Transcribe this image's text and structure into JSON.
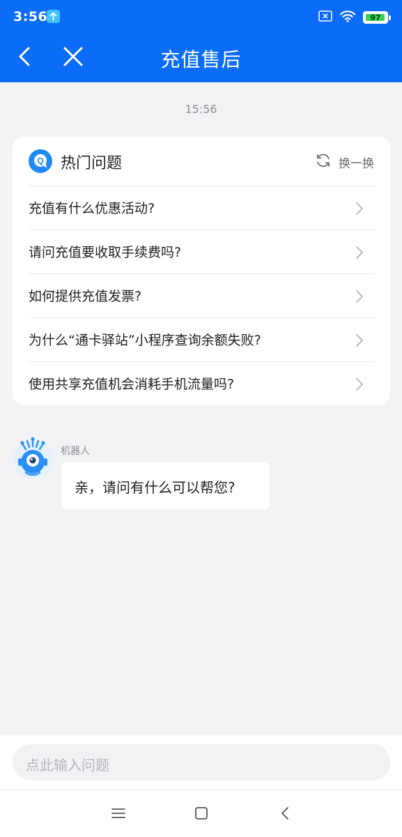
{
  "status_bar": {
    "time": "3:56",
    "battery": "97",
    "battery_level": 0.97,
    "icons": [
      "upload-icon",
      "sim-off-icon",
      "wifi-icon",
      "battery-icon"
    ]
  },
  "nav": {
    "title": "充值售后",
    "icons": [
      "back-icon",
      "close-icon"
    ]
  },
  "chat": {
    "timestamp": "15:56"
  },
  "hot_questions": {
    "title": "热门问题",
    "refresh_label": "换一换",
    "items": [
      {
        "text": "充值有什么优惠活动?"
      },
      {
        "text": "请问充值要收取手续费吗?"
      },
      {
        "text": "如何提供充值发票?"
      },
      {
        "text": "为什么“通卡驿站”小程序查询余额失败?"
      },
      {
        "text": "使用共享充值机会消耗手机流量吗?"
      }
    ]
  },
  "bot_message": {
    "sender": "机器人",
    "text": "亲，请问有什么可以帮您?"
  },
  "input": {
    "placeholder": "点此输入问题"
  },
  "colors": {
    "primary": "#0b6cf7",
    "background": "#f2f3f5",
    "card": "#ffffff",
    "battery": "#39d353"
  }
}
